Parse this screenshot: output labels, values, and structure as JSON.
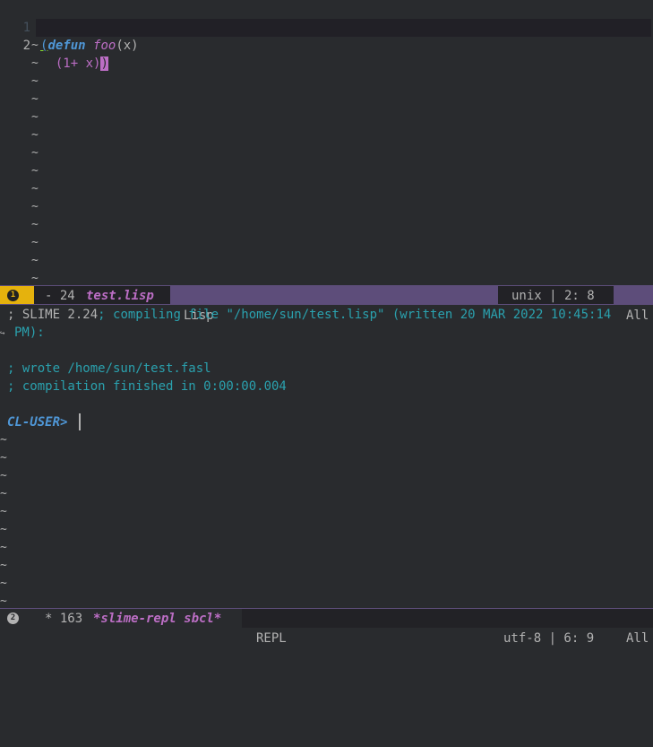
{
  "editor": {
    "lines": [
      {
        "num": "1",
        "open": "(",
        "kw": "defun",
        "sp": " ",
        "fn": "foo",
        "args": "(x)"
      },
      {
        "num": "2",
        "indent": "  (1+ x)",
        "close": ")"
      }
    ],
    "tilde": "~"
  },
  "modeline_top": {
    "window_number": "1",
    "state": "- 24",
    "buffer_name": "test.lisp",
    "major_mode": "Lisp",
    "encoding": "unix | 2: 8",
    "position": "All"
  },
  "repl": {
    "line1a": "; SLIME 2.24",
    "line1b": "; compiling file \"/home/sun/test.lisp\" (written 20 MAR 2022 10:45:14",
    "line2": "PM):",
    "line3": "; wrote /home/sun/test.fasl",
    "line4": "; compilation finished in 0:00:00.004",
    "prompt": "CL-USER>"
  },
  "modeline_bottom": {
    "window_number": "2",
    "state": "* 163",
    "buffer_name": "*slime-repl sbcl*",
    "major_mode": "REPL",
    "encoding": "utf-8 | 6: 9",
    "position": "All"
  },
  "colors": {
    "background": "#292b2e",
    "keyword": "#4f97d7",
    "function": "#bc6ec5",
    "comment": "#2aa1ae",
    "window_badge": "#e5b20d",
    "modeline_accent": "#5d4d7a"
  }
}
